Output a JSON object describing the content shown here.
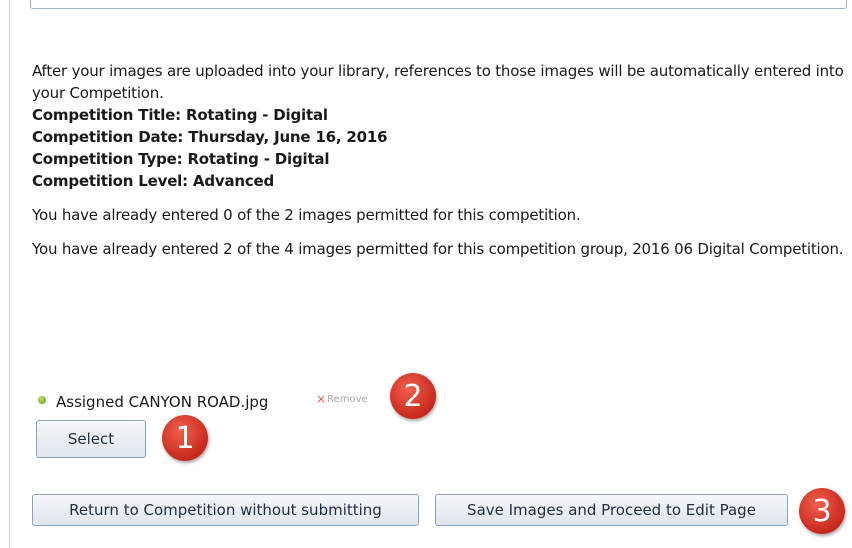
{
  "intro_text": "After your images are uploaded into your library, references to those images will be automatically entered into your Competition.",
  "competition": {
    "title": "Competition Title: Rotating - Digital",
    "date": "Competition Date: Thursday, June 16, 2016",
    "type": "Competition Type: Rotating - Digital",
    "level": "Competition Level: Advanced"
  },
  "entered_text": "You have already entered 0 of the 2 images permitted for this competition.",
  "group_text": "You have already entered 2 of the 4 images permitted for this competition group, 2016 06 Digital Competition.",
  "assigned": {
    "label": "Assigned CANYON ROAD.jpg",
    "status_color": "#6aab25",
    "remove_icon": "×",
    "remove_label": "Remove"
  },
  "buttons": {
    "select": "Select",
    "return": "Return to Competition without submitting",
    "save": "Save Images and Proceed to Edit Page"
  },
  "badges": [
    "1",
    "2",
    "3"
  ],
  "colors": {
    "badge": "#d9362a",
    "button_border": "#8aa0b4"
  }
}
